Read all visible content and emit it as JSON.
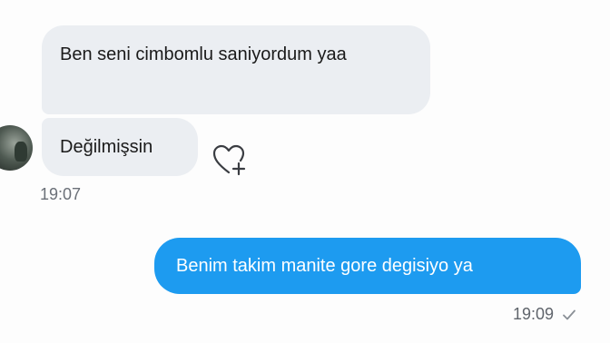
{
  "messages": {
    "incoming": [
      {
        "text": "Ben seni cimbomlu saniyordum yaa"
      },
      {
        "text": "Değilmişsin"
      }
    ],
    "incoming_time": "19:07",
    "outgoing": [
      {
        "text": "Benim takim manite gore degisiyo ya"
      }
    ],
    "outgoing_time": "19:09"
  },
  "colors": {
    "incoming_bubble": "#ebeef2",
    "outgoing_bubble": "#1d9bf0",
    "timestamp": "#6b7078"
  },
  "icons": {
    "reaction": "heart-plus-icon",
    "read_receipt": "check-icon",
    "avatar": "avatar"
  }
}
